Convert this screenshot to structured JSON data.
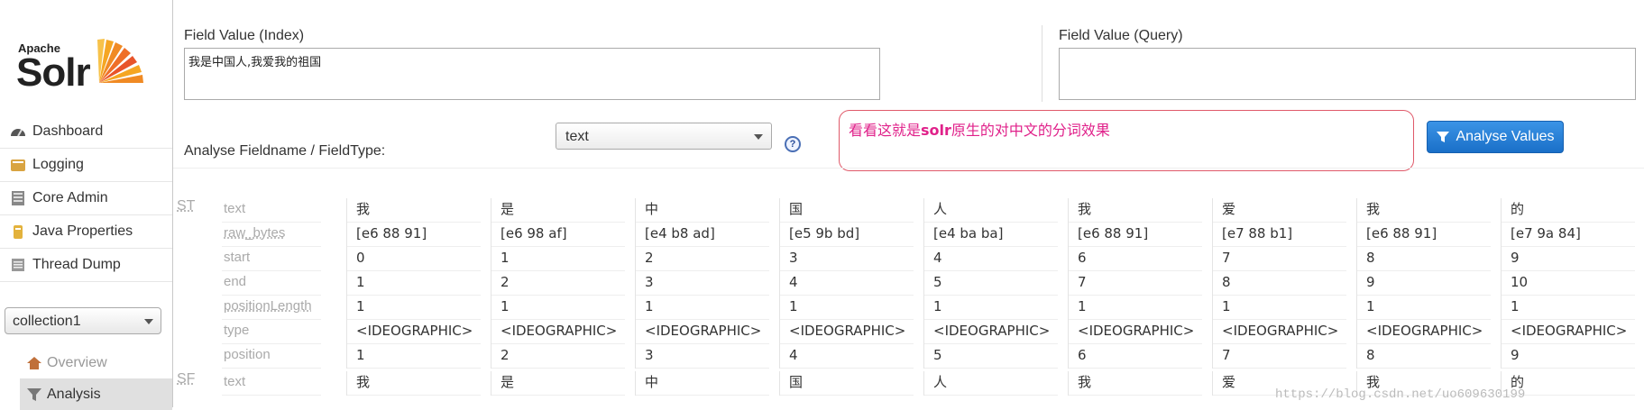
{
  "logo": {
    "apache": "Apache",
    "solr": "Solr"
  },
  "nav": [
    {
      "label": "Dashboard",
      "icon": "dashboard-icon"
    },
    {
      "label": "Logging",
      "icon": "logging-icon"
    },
    {
      "label": "Core Admin",
      "icon": "core-admin-icon"
    },
    {
      "label": "Java Properties",
      "icon": "java-properties-icon"
    },
    {
      "label": "Thread Dump",
      "icon": "thread-dump-icon"
    }
  ],
  "core_selector": {
    "value": "collection1"
  },
  "core_nav": [
    {
      "label": "Overview",
      "icon": "overview-icon",
      "active": false
    },
    {
      "label": "Analysis",
      "icon": "analysis-icon",
      "active": true
    }
  ],
  "form": {
    "index_label": "Field Value (Index)",
    "index_value": "我是中国人,我爱我的祖国",
    "query_label": "Field Value (Query)",
    "query_value": "",
    "fieldtype_label": "Analyse Fieldname / FieldType:",
    "fieldtype_value": "text",
    "help": "?",
    "analyse_button": "Analyse Values"
  },
  "annotation": {
    "before": "看看这就是",
    "bold": "solr",
    "after": "原生的对中文的分词效果"
  },
  "attributes": [
    "text",
    "raw_bytes",
    "start",
    "end",
    "positionLength",
    "type",
    "position"
  ],
  "stages": [
    {
      "key": "ST",
      "tokens": [
        {
          "text": "我",
          "raw_bytes": "[e6 88 91]",
          "start": "0",
          "end": "1",
          "positionLength": "1",
          "type": "<IDEOGRAPHIC>",
          "position": "1"
        },
        {
          "text": "是",
          "raw_bytes": "[e6 98 af]",
          "start": "1",
          "end": "2",
          "positionLength": "1",
          "type": "<IDEOGRAPHIC>",
          "position": "2"
        },
        {
          "text": "中",
          "raw_bytes": "[e4 b8 ad]",
          "start": "2",
          "end": "3",
          "positionLength": "1",
          "type": "<IDEOGRAPHIC>",
          "position": "3"
        },
        {
          "text": "国",
          "raw_bytes": "[e5 9b bd]",
          "start": "3",
          "end": "4",
          "positionLength": "1",
          "type": "<IDEOGRAPHIC>",
          "position": "4"
        },
        {
          "text": "人",
          "raw_bytes": "[e4 ba ba]",
          "start": "4",
          "end": "5",
          "positionLength": "1",
          "type": "<IDEOGRAPHIC>",
          "position": "5"
        },
        {
          "text": "我",
          "raw_bytes": "[e6 88 91]",
          "start": "6",
          "end": "7",
          "positionLength": "1",
          "type": "<IDEOGRAPHIC>",
          "position": "6"
        },
        {
          "text": "爱",
          "raw_bytes": "[e7 88 b1]",
          "start": "7",
          "end": "8",
          "positionLength": "1",
          "type": "<IDEOGRAPHIC>",
          "position": "7"
        },
        {
          "text": "我",
          "raw_bytes": "[e6 88 91]",
          "start": "8",
          "end": "9",
          "positionLength": "1",
          "type": "<IDEOGRAPHIC>",
          "position": "8"
        },
        {
          "text": "的",
          "raw_bytes": "[e7 9a 84]",
          "start": "9",
          "end": "10",
          "positionLength": "1",
          "type": "<IDEOGRAPHIC>",
          "position": "9"
        }
      ]
    },
    {
      "key": "SF",
      "tokens": [
        {
          "text": "我"
        },
        {
          "text": "是"
        },
        {
          "text": "中"
        },
        {
          "text": "国"
        },
        {
          "text": "人"
        },
        {
          "text": "我"
        },
        {
          "text": "爱"
        },
        {
          "text": "我"
        },
        {
          "text": "的"
        }
      ]
    }
  ],
  "watermark": "https://blog.csdn.net/uo609630199",
  "colors": {
    "accent": "#1a6fc8",
    "annotation": "#e0218a",
    "annotation_border": "#e05a6a"
  }
}
